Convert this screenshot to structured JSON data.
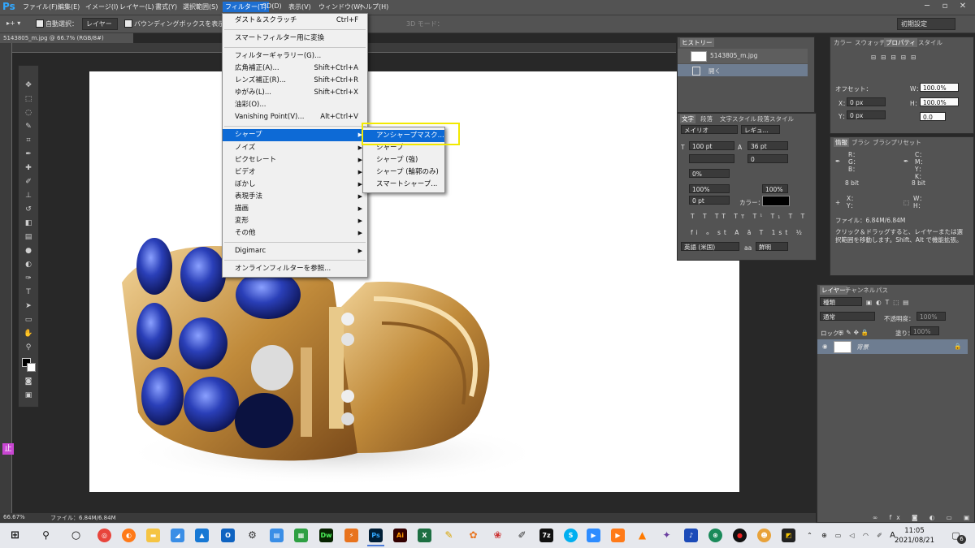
{
  "app": {
    "logo": "Ps"
  },
  "menubar": {
    "items": [
      "ファイル(F)",
      "編集(E)",
      "イメージ(I)",
      "レイヤー(L)",
      "書式(Y)",
      "選択範囲(S)",
      "フィルター(T)",
      "3D(D)",
      "表示(V)",
      "ウィンドウ(W)",
      "ヘルプ(H)"
    ]
  },
  "optionsbar": {
    "auto_select": "自動選択：",
    "auto_select_value": "レイヤー",
    "bounding_box": "バウンディングボックスを表示",
    "mode_3d": "3D モード：",
    "workspace": "初期設定"
  },
  "document": {
    "tab": "5143805_m.jpg @ 66.7% (RGB/8#)"
  },
  "status": {
    "zoom": "66.67%",
    "file": "ファイル：6.84M/6.84M"
  },
  "filter_menu": {
    "items": [
      {
        "label": "ダスト＆スクラッチ",
        "shortcut": "Ctrl+F"
      },
      {
        "label": "スマートフィルター用に変換",
        "shortcut": ""
      },
      {
        "label": "フィルターギャラリー(G)...",
        "shortcut": ""
      },
      {
        "label": "広角補正(A)...",
        "shortcut": "Shift+Ctrl+A"
      },
      {
        "label": "レンズ補正(R)...",
        "shortcut": "Shift+Ctrl+R"
      },
      {
        "label": "ゆがみ(L)...",
        "shortcut": "Shift+Ctrl+X"
      },
      {
        "label": "油彩(O)...",
        "shortcut": ""
      },
      {
        "label": "Vanishing Point(V)...",
        "shortcut": "Alt+Ctrl+V"
      },
      {
        "label": "シャープ",
        "shortcut": ""
      },
      {
        "label": "ノイズ",
        "shortcut": ""
      },
      {
        "label": "ピクセレート",
        "shortcut": ""
      },
      {
        "label": "ビデオ",
        "shortcut": ""
      },
      {
        "label": "ぼかし",
        "shortcut": ""
      },
      {
        "label": "表現手法",
        "shortcut": ""
      },
      {
        "label": "描画",
        "shortcut": ""
      },
      {
        "label": "変形",
        "shortcut": ""
      },
      {
        "label": "その他",
        "shortcut": ""
      },
      {
        "label": "Digimarc",
        "shortcut": ""
      },
      {
        "label": "オンラインフィルターを参照...",
        "shortcut": ""
      }
    ]
  },
  "sharpen_submenu": {
    "items": [
      "アンシャープマスク...",
      "シャープ",
      "シャープ (強)",
      "シャープ (輪郭のみ)",
      "スマートシャープ..."
    ]
  },
  "history": {
    "tab": "ヒストリー",
    "snapshot": "5143805_m.jpg",
    "step": "開く"
  },
  "character": {
    "tabs": [
      "文字",
      "段落",
      "文字スタイル",
      "段落スタイル"
    ],
    "font": "メイリオ",
    "style": "レギュ...",
    "size": "100 pt",
    "leading": "36 pt",
    "tracking": "0",
    "scale_pct": "0%",
    "vscale": "100%",
    "hscale": "100%",
    "baseline": "0 pt",
    "color_label": "カラー：",
    "lang": "英語 (米国)",
    "aa": "aa",
    "aa_value": "鮮明"
  },
  "properties": {
    "tabs": [
      "カラー",
      "スウォッチ",
      "プロパティ",
      "スタイル"
    ],
    "offset": "オフセット：",
    "w_label": "W：",
    "w_value": "100.0%",
    "h_label": "H：",
    "h_value": "100.0%",
    "x_label": "X：",
    "x_value": "0 px",
    "y_label": "Y：",
    "y_value": "0 px",
    "angle": "0.0"
  },
  "info": {
    "tabs": [
      "情報",
      "ブラシ",
      "ブラシプリセット"
    ],
    "rgb": [
      "R：",
      "G：",
      "B："
    ],
    "cmyk": [
      "C：",
      "M：",
      "Y：",
      "K："
    ],
    "bit": "8 bit",
    "xy": [
      "X：",
      "Y："
    ],
    "wh": [
      "W：",
      "H："
    ],
    "file": "ファイル：6.84M/6.84M",
    "hint": "クリック＆ドラッグすると、レイヤーまたは選択範囲を移動します。Shift、Alt で機能拡張。"
  },
  "layers": {
    "tabs": [
      "レイヤー",
      "チャンネル",
      "パス"
    ],
    "kind": "種類",
    "blend": "通常",
    "opacity_label": "不透明度：",
    "opacity": "100%",
    "lock_label": "ロック：",
    "fill_label": "塗り：",
    "fill": "100%",
    "layer_name": "背景"
  },
  "taskbar": {
    "time": "11:05",
    "date": "2021/08/21",
    "ime": "A",
    "notify_count": "6"
  },
  "colors": {
    "accent": "#0d6ad6",
    "highlight": "#f2e900",
    "ps_blue": "#31a8ff"
  }
}
